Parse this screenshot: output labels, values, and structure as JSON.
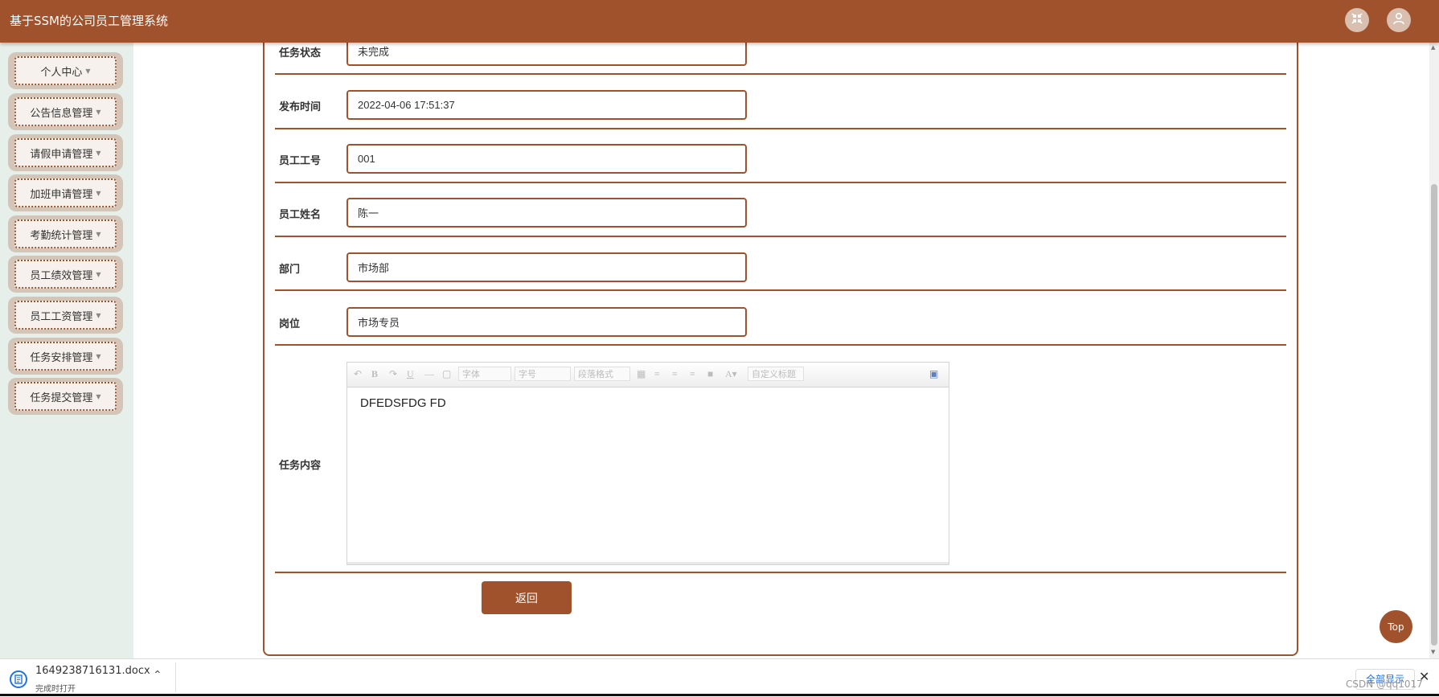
{
  "header": {
    "title": "基于SSM的公司员工管理系统",
    "fullscreen_icon": "fullscreen-exit-icon",
    "user_icon": "user-icon"
  },
  "sidebar": {
    "items": [
      {
        "label": "个人中心"
      },
      {
        "label": "公告信息管理"
      },
      {
        "label": "请假申请管理"
      },
      {
        "label": "加班申请管理"
      },
      {
        "label": "考勤统计管理"
      },
      {
        "label": "员工绩效管理"
      },
      {
        "label": "员工工资管理"
      },
      {
        "label": "任务安排管理"
      },
      {
        "label": "任务提交管理"
      }
    ]
  },
  "form": {
    "fields": [
      {
        "label": "任务状态",
        "value": "未完成"
      },
      {
        "label": "发布时间",
        "value": "2022-04-06 17:51:37"
      },
      {
        "label": "员工工号",
        "value": "001"
      },
      {
        "label": "员工姓名",
        "value": "陈一"
      },
      {
        "label": "部门",
        "value": "市场部"
      },
      {
        "label": "岗位",
        "value": "市场专员"
      }
    ],
    "content_label": "任务内容",
    "editor": {
      "font_family_placeholder": "字体",
      "font_size_placeholder": "字号",
      "paragraph_placeholder": "段落格式",
      "custom_title_placeholder": "自定义标题",
      "body": "DFEDSFDG FD"
    },
    "back_button": "返回"
  },
  "top_button": "Top",
  "download_bar": {
    "filename": "1649238716131.docx",
    "status": "完成时打开",
    "show_all": "全部显示",
    "watermark": "CSDN @qq1017"
  },
  "colors": {
    "accent": "#a0522d",
    "sidebar_bg": "#e6efea",
    "menu_item_bg": "#d3c6b8"
  }
}
